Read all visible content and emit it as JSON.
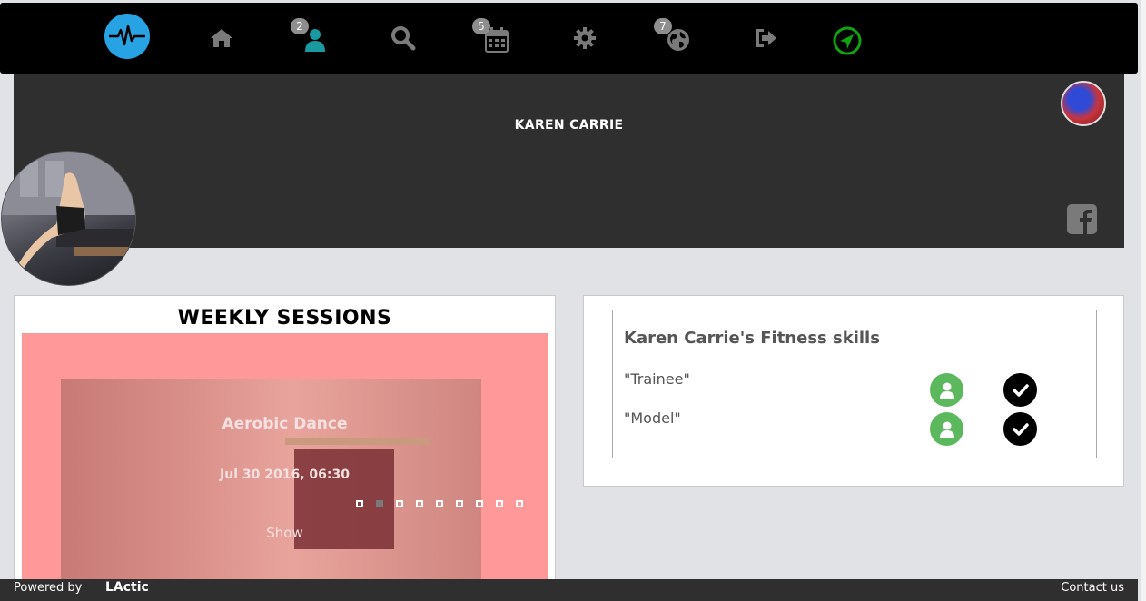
{
  "nav": {
    "items": [
      {
        "name": "home",
        "icon": "home-icon",
        "badge": null
      },
      {
        "name": "friends",
        "icon": "user-icon",
        "badge": "2"
      },
      {
        "name": "search",
        "icon": "search-icon",
        "badge": null
      },
      {
        "name": "calendar",
        "icon": "calendar-icon",
        "badge": "5"
      },
      {
        "name": "settings",
        "icon": "gear-icon",
        "badge": null
      },
      {
        "name": "globe",
        "icon": "globe-icon",
        "badge": "7"
      },
      {
        "name": "logout",
        "icon": "sign-out-icon",
        "badge": null
      },
      {
        "name": "location",
        "icon": "location-arrow-icon",
        "badge": null
      }
    ],
    "logo_icon": "heartbeat-icon",
    "colors": {
      "logo": "#27a3e3",
      "friends": "#1a9aa0",
      "location": "#0fa30f",
      "icons": "#7a7a7a"
    }
  },
  "profile": {
    "name": "KAREN CARRIE"
  },
  "sessions": {
    "title": "WEEKLY SESSIONS",
    "slide": {
      "title": "Aerobic Dance",
      "date": "Jul 30 2016, 06:30",
      "action": "Show"
    },
    "dot_count": 9,
    "active_dot": 1,
    "slide_bg": "#ff9999"
  },
  "skills": {
    "title": "Karen Carrie's Fitness skills",
    "items": [
      {
        "label": "\"Trainee\""
      },
      {
        "label": "\"Model\""
      }
    ],
    "colors": {
      "user": "#5cb85c",
      "check": "#000000"
    }
  },
  "footer": {
    "powered": "Powered by",
    "brand": "LActic",
    "contact": "Contact us"
  }
}
